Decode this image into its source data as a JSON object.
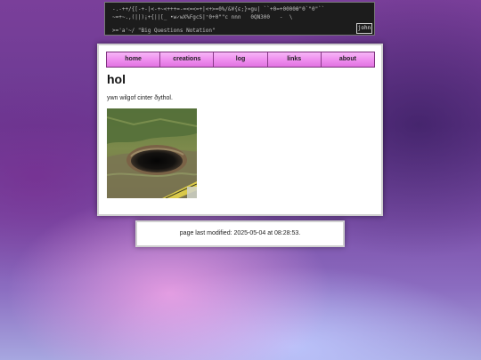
{
  "banner": {
    "row1": "-.-++/{[-+-|<-+~<+++=-=<=<=+|<+>=0%/&¥{ɛ;}¤gu| ``+0=+0000Ɵ\"0`\"0\"``",
    "row2": "~=+~.,(||)¡+{||[_ •w✓wX%FgcS|⁺0+0\"\"c nnn",
    "row2_right": "0QN300   -  \\",
    "row3": ">='a'~/ \"Big Questions Notation\"",
    "tag": "john"
  },
  "nav": {
    "items": [
      {
        "label": "home"
      },
      {
        "label": "creations"
      },
      {
        "label": "log"
      },
      {
        "label": "links"
      },
      {
        "label": "about"
      }
    ]
  },
  "page": {
    "title": "hol",
    "description": "ywn wilgof cinter ðythol."
  },
  "footer": {
    "text": "page last modified: 2025-05-04 at 08:28:53."
  }
}
